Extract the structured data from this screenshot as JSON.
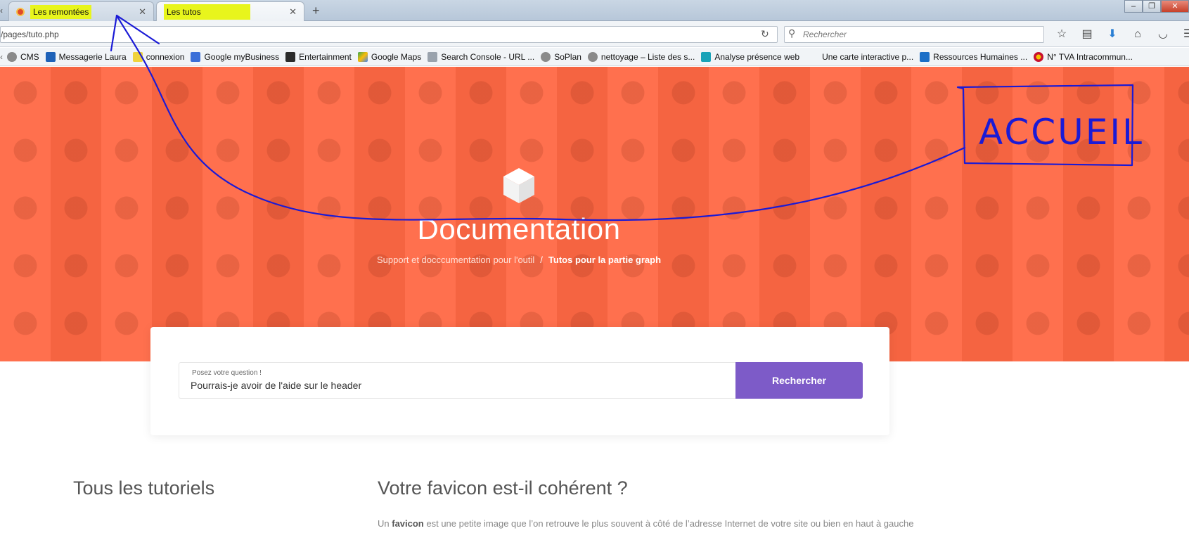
{
  "browser": {
    "tabs": [
      {
        "title": "Les remontées",
        "active": false
      },
      {
        "title": "Les tutos",
        "active": true
      }
    ],
    "url": "/pages/tuto.php",
    "search_placeholder": "Rechercher",
    "highlight_color": "#e8f51c"
  },
  "bookmarks": [
    {
      "label": "CMS",
      "icon": "globe-icon"
    },
    {
      "label": "Messagerie Laura",
      "icon": "outlook-icon"
    },
    {
      "label": "connexion",
      "icon": "folder-icon"
    },
    {
      "label": "Google myBusiness",
      "icon": "google-mybusiness-icon"
    },
    {
      "label": "Entertainment",
      "icon": "book-icon"
    },
    {
      "label": "Google Maps",
      "icon": "google-maps-icon"
    },
    {
      "label": "Search Console - URL ...",
      "icon": "search-console-icon"
    },
    {
      "label": "SoPlan",
      "icon": "globe-icon"
    },
    {
      "label": "nettoyage – Liste des s...",
      "icon": "globe-icon"
    },
    {
      "label": "Analyse présence web",
      "icon": "analysis-icon"
    },
    {
      "label": "Une carte interactive p...",
      "icon": ""
    },
    {
      "label": "Ressources Humaines ...",
      "icon": "sharepoint-icon"
    },
    {
      "label": "N° TVA Intracommun...",
      "icon": "eu-flag-icon"
    }
  ],
  "hero": {
    "title": "Documentation",
    "breadcrumb": {
      "root": "Support et docccumentation pour l'outil",
      "separator": "/",
      "current": "Tutos pour la partie graph"
    },
    "bg_color": "#ff6844"
  },
  "search": {
    "label": "Posez votre question !",
    "value": "Pourrais-je avoir de l'aide sur le header",
    "button": "Rechercher",
    "accent": "#7d5bc8"
  },
  "content": {
    "sidebar_title": "Tous les tutoriels",
    "article_title": "Votre favicon est-il cohérent ?",
    "article_text_before": "Un ",
    "article_text_bold": "favicon",
    "article_text_after": " est une petite image que l’on retrouve le plus souvent à côté de l’adresse Internet de votre site ou bien en haut à gauche"
  },
  "annotation": {
    "text": "ACCUEIL",
    "color": "#1a1ad6"
  }
}
